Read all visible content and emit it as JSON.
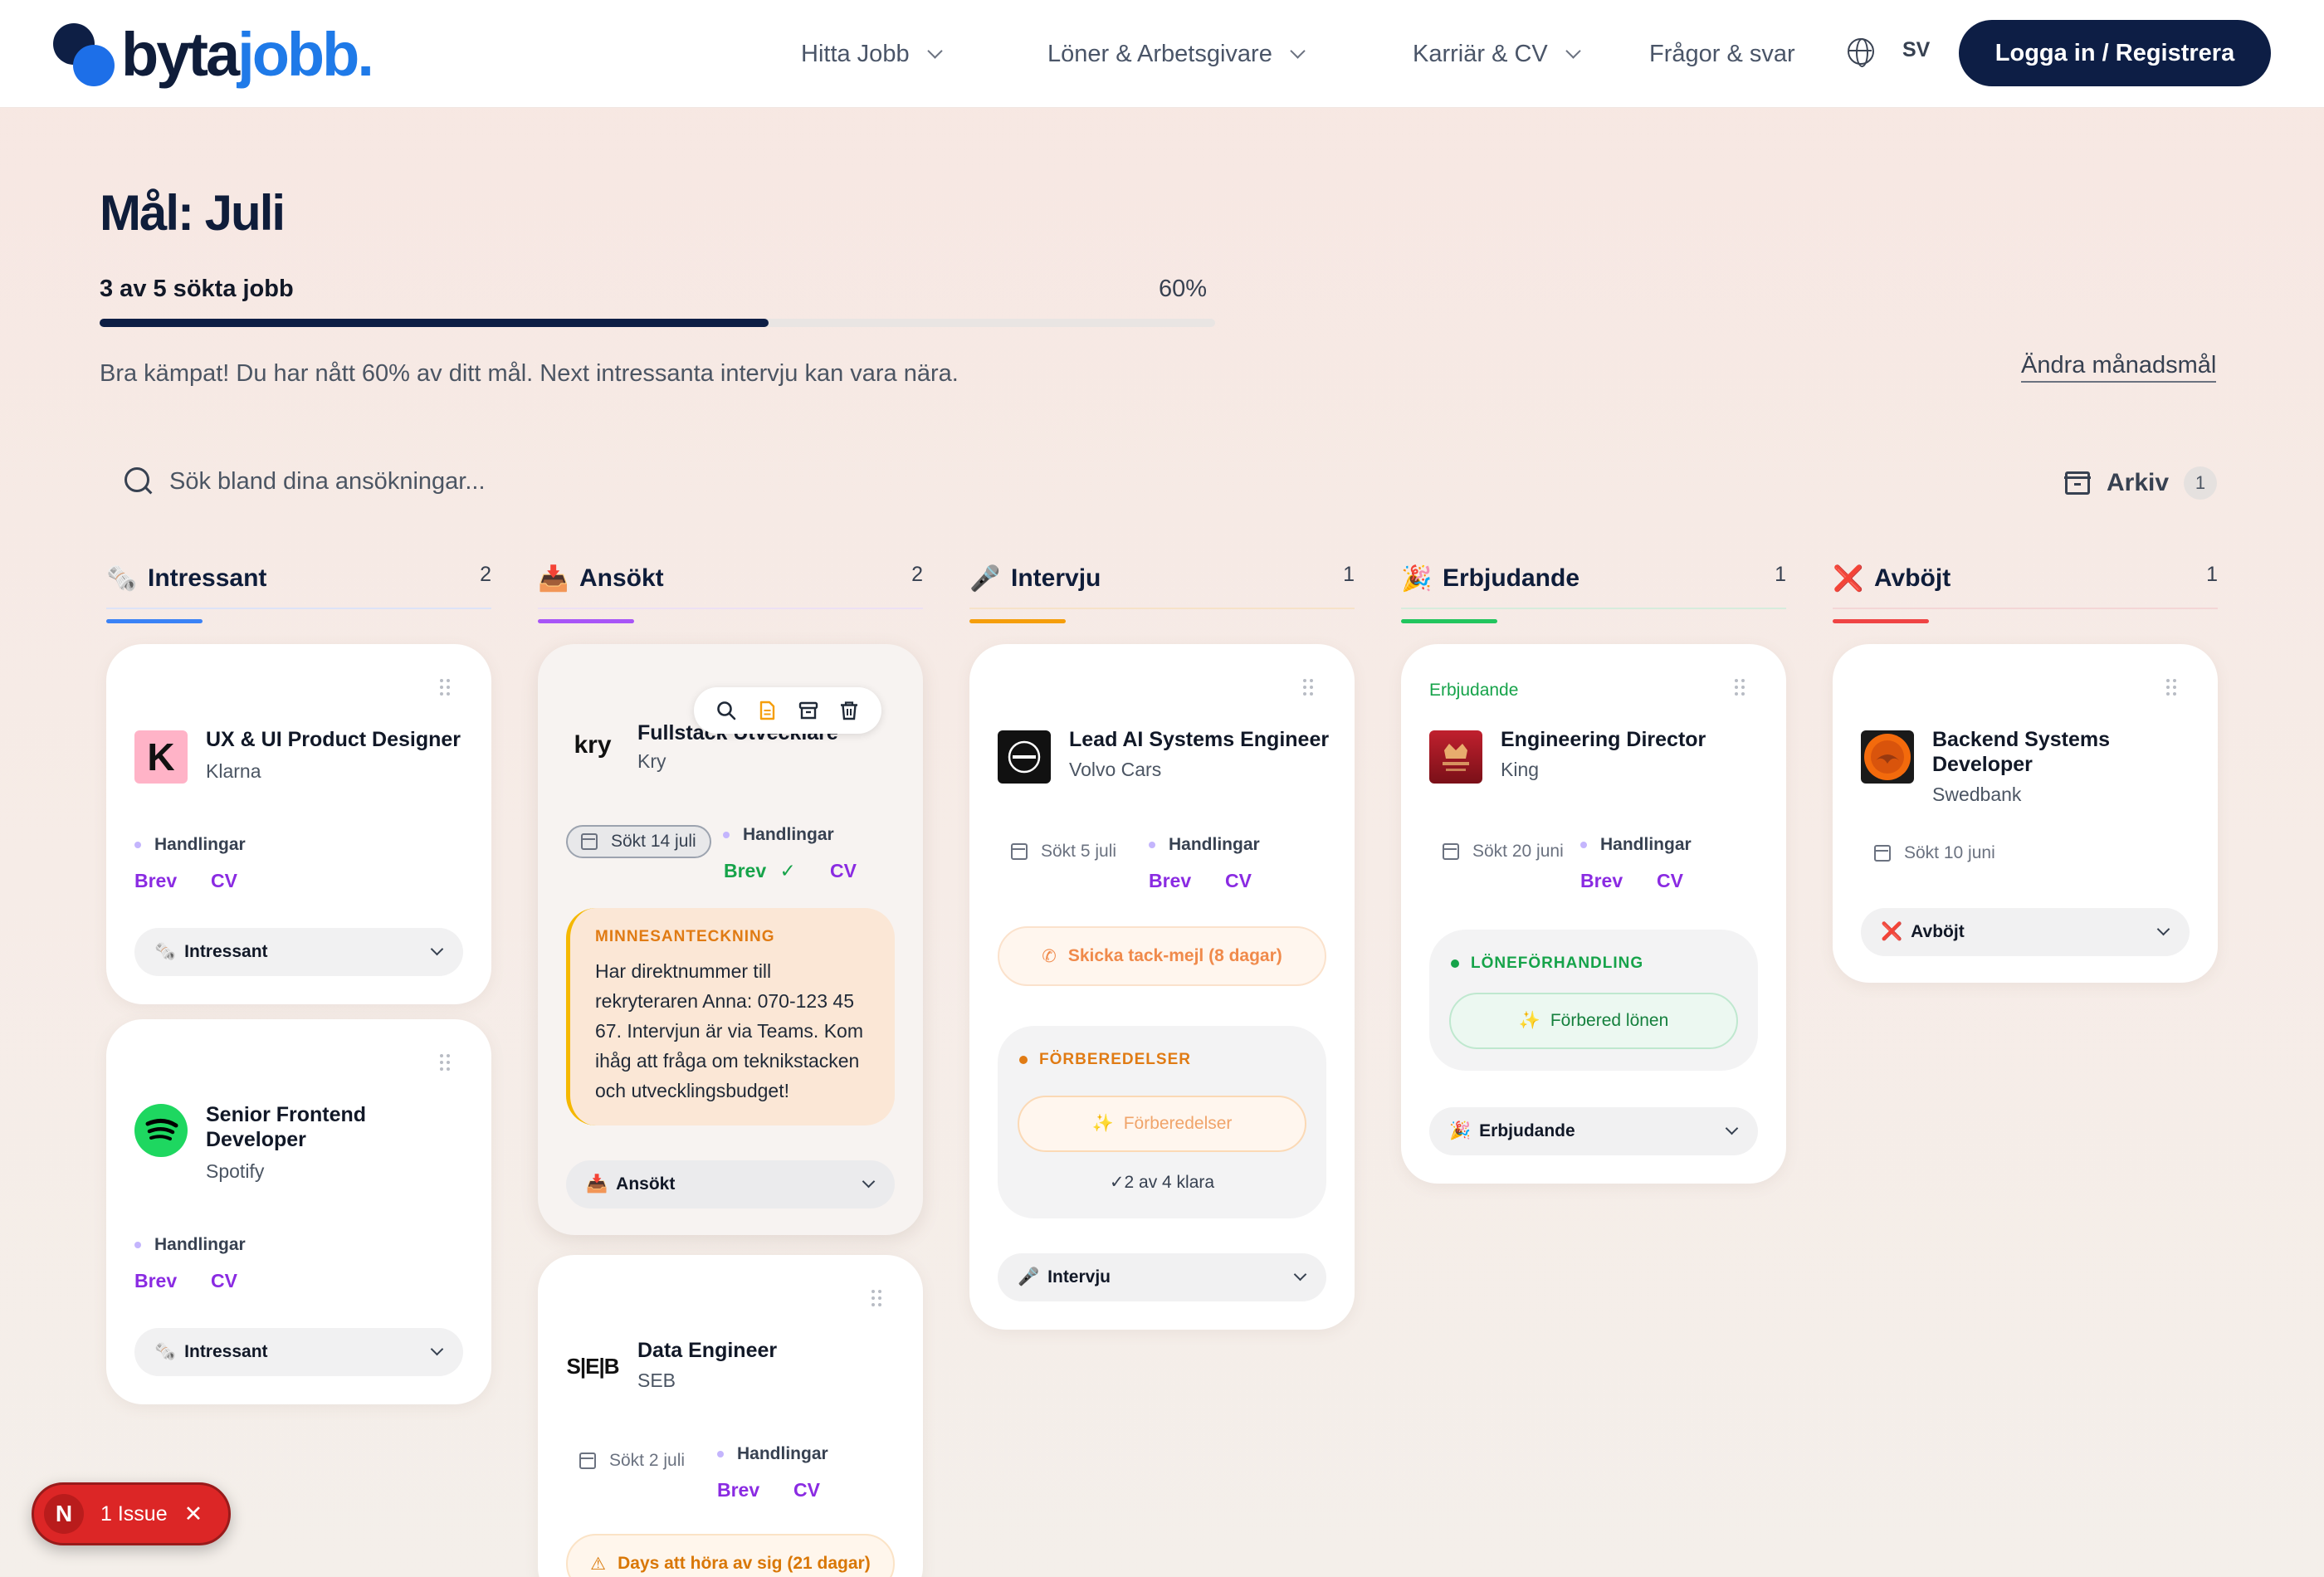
{
  "header": {
    "logo_part1": "byta",
    "logo_part2": "jobb.",
    "nav": [
      "Hitta Jobb",
      "Löner & Arbetsgivare",
      "Karriär & CV",
      "Frågor & svar"
    ],
    "language": "SV",
    "login_label": "Logga in / Registrera"
  },
  "goal": {
    "title": "Mål: Juli",
    "progress_label": "3 av 5 sökta jobb",
    "percent_label": "60%",
    "progress_fraction": 0.6,
    "message": "Bra kämpat! Du har nått 60% av ditt mål. Next intressanta intervju kan vara nära.",
    "change_link": "Ändra månadsmål"
  },
  "search": {
    "placeholder": "Sök bland dina ansökningar..."
  },
  "archive": {
    "label": "Arkiv",
    "count": "1"
  },
  "columns": [
    {
      "icon": "🗞️",
      "name": "Intressant",
      "count": "2",
      "color": "#3b82f6"
    },
    {
      "icon": "📥",
      "name": "Ansökt",
      "count": "2",
      "color": "#a855f7"
    },
    {
      "icon": "🎤",
      "name": "Intervju",
      "count": "1",
      "color": "#f59e0b"
    },
    {
      "icon": "🎉",
      "name": "Erbjudande",
      "count": "1",
      "color": "#22c55e"
    },
    {
      "icon": "❌",
      "name": "Avböjt",
      "count": "1",
      "color": "#ef4444"
    }
  ],
  "cards": {
    "klarna": {
      "logo": "K",
      "title": "UX & UI Product Designer",
      "company": "Klarna",
      "docs": "Handlingar",
      "brev": "Brev",
      "cv": "CV",
      "status": "Intressant",
      "status_icon": "🗞️"
    },
    "spotify": {
      "title": "Senior Frontend Developer",
      "company": "Spotify",
      "docs": "Handlingar",
      "brev": "Brev",
      "cv": "CV",
      "status": "Intressant",
      "status_icon": "🗞️"
    },
    "kry": {
      "logo": "kry",
      "title": "Fullstack Utvecklare",
      "company": "Kry",
      "sent": "Sökt 14 juli",
      "docs": "Handlingar",
      "brev": "Brev",
      "check": "✓",
      "cv": "CV",
      "note_heading": "MINNESANTECKNING",
      "note_text": "Har direktnummer till rekryteraren Anna: 070-123 45 67. Intervjun är via Teams. Kom ihåg att fråga om teknikstacken och utvecklingsbudget!",
      "status": "Ansökt",
      "status_icon": "📥"
    },
    "seb": {
      "logo": "S|E|B",
      "title": "Data Engineer",
      "company": "SEB",
      "sent": "Sökt 2 juli",
      "docs": "Handlingar",
      "brev": "Brev",
      "cv": "CV",
      "warning": "Days att höra av sig (21 dagar)"
    },
    "volvo": {
      "title": "Lead AI Systems Engineer",
      "company": "Volvo Cars",
      "sent": "Sökt 5 juli",
      "docs": "Handlingar",
      "brev": "Brev",
      "cv": "CV",
      "action": "Skicka tack-mejl (8 dagar)",
      "prep_heading": "FÖRBEREDELSER",
      "prep_button": "Förberedelser",
      "prep_footer": "✓2 av 4 klara",
      "status": "Intervju",
      "status_icon": "🎤"
    },
    "king": {
      "tag": "Erbjudande",
      "title": "Engineering Director",
      "company": "King",
      "sent": "Sökt 20 juni",
      "docs": "Handlingar",
      "brev": "Brev",
      "cv": "CV",
      "prep_heading": "LÖNEFÖRHANDLING",
      "prep_button": "Förbered lönen",
      "status": "Erbjudande",
      "status_icon": "🎉"
    },
    "swedbank": {
      "title": "Backend Systems Developer",
      "company": "Swedbank",
      "sent": "Sökt 10 juni",
      "status": "Avböjt",
      "status_icon": "❌"
    }
  },
  "issue_badge": {
    "letter": "N",
    "label": "1 Issue",
    "close": "✕"
  }
}
